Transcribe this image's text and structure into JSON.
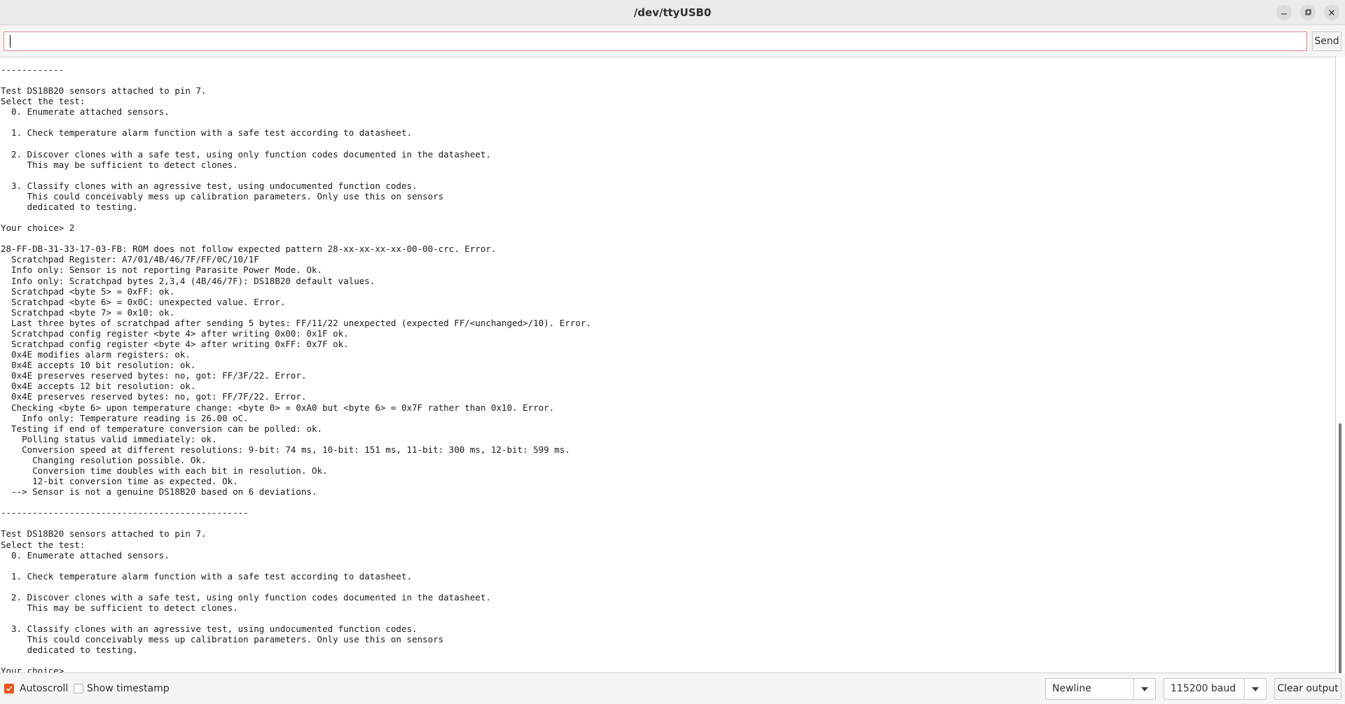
{
  "window": {
    "title": "/dev/ttyUSB0",
    "minimize_icon": "minimize-icon",
    "maximize_icon": "maximize-icon",
    "close_icon": "close-icon"
  },
  "send": {
    "input_value": "",
    "button_label": "Send"
  },
  "output": {
    "lines": [
      "------------",
      "",
      "Test DS18B20 sensors attached to pin 7.",
      "Select the test:",
      "  0. Enumerate attached sensors.",
      "",
      "  1. Check temperature alarm function with a safe test according to datasheet.",
      "",
      "  2. Discover clones with a safe test, using only function codes documented in the datasheet.",
      "     This may be sufficient to detect clones.",
      "",
      "  3. Classify clones with an agressive test, using undocumented function codes.",
      "     This could conceivably mess up calibration parameters. Only use this on sensors",
      "     dedicated to testing.",
      "",
      "Your choice> 2",
      "",
      "28-FF-DB-31-33-17-03-FB: ROM does not follow expected pattern 28-xx-xx-xx-xx-00-00-crc. Error.",
      "  Scratchpad Register: A7/01/4B/46/7F/FF/0C/10/1F",
      "  Info only: Sensor is not reporting Parasite Power Mode. Ok.",
      "  Info only: Scratchpad bytes 2,3,4 (4B/46/7F): DS18B20 default values.",
      "  Scratchpad <byte 5> = 0xFF: ok.",
      "  Scratchpad <byte 6> = 0x0C: unexpected value. Error.",
      "  Scratchpad <byte 7> = 0x10: ok.",
      "  Last three bytes of scratchpad after sending 5 bytes: FF/11/22 unexpected (expected FF/<unchanged>/10). Error.",
      "  Scratchpad config register <byte 4> after writing 0x00: 0x1F ok.",
      "  Scratchpad config register <byte 4> after writing 0xFF: 0x7F ok.",
      "  0x4E modifies alarm registers: ok.",
      "  0x4E accepts 10 bit resolution: ok.",
      "  0x4E preserves reserved bytes: no, got: FF/3F/22. Error.",
      "  0x4E accepts 12 bit resolution: ok.",
      "  0x4E preserves reserved bytes: no, got: FF/7F/22. Error.",
      "  Checking <byte 6> upon temperature change: <byte 0> = 0xA0 but <byte 6> = 0x7F rather than 0x10. Error.",
      "    Info only: Temperature reading is 26.00 oC.",
      "  Testing if end of temperature conversion can be polled: ok.",
      "    Polling status valid immediately: ok.",
      "    Conversion speed at different resolutions: 9-bit: 74 ms, 10-bit: 151 ms, 11-bit: 300 ms, 12-bit: 599 ms.",
      "      Changing resolution possible. Ok.",
      "      Conversion time doubles with each bit in resolution. Ok.",
      "      12-bit conversion time as expected. Ok.",
      "  --> Sensor is not a genuine DS18B20 based on 6 deviations.",
      "",
      "-----------------------------------------------",
      "",
      "Test DS18B20 sensors attached to pin 7.",
      "Select the test:",
      "  0. Enumerate attached sensors.",
      "",
      "  1. Check temperature alarm function with a safe test according to datasheet.",
      "",
      "  2. Discover clones with a safe test, using only function codes documented in the datasheet.",
      "     This may be sufficient to detect clones.",
      "",
      "  3. Classify clones with an agressive test, using undocumented function codes.",
      "     This could conceivably mess up calibration parameters. Only use this on sensors",
      "     dedicated to testing.",
      "",
      "Your choice>"
    ]
  },
  "footer": {
    "autoscroll_label": "Autoscroll",
    "autoscroll_checked": true,
    "timestamp_label": "Show timestamp",
    "timestamp_checked": false,
    "line_ending": "Newline",
    "baud_rate": "115200 baud",
    "clear_label": "Clear output"
  },
  "colors": {
    "accent": "#e95420",
    "input_border": "#e08a8a"
  }
}
